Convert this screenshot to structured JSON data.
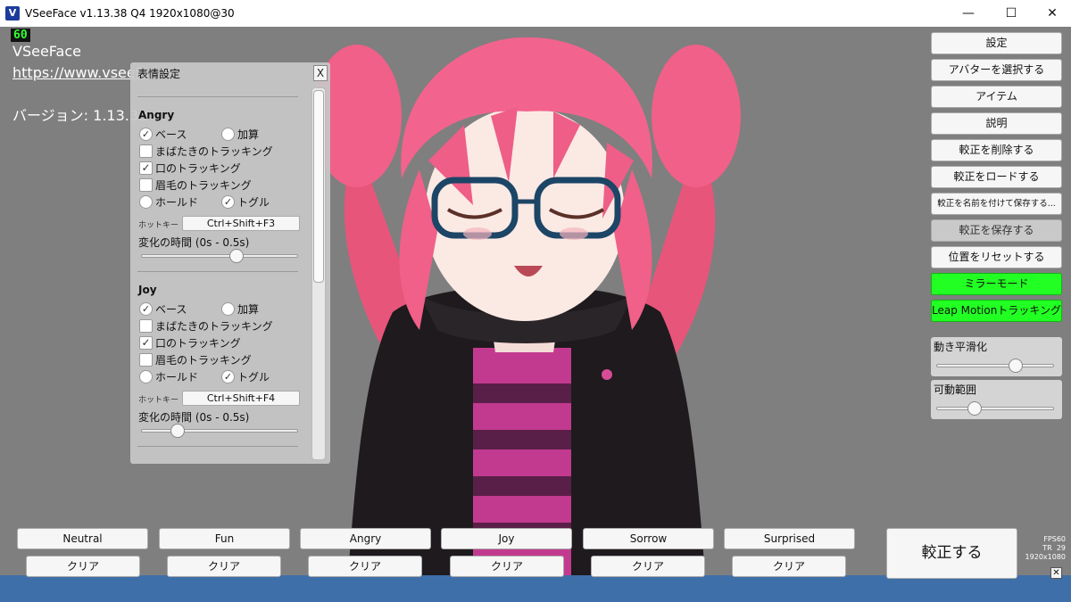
{
  "window": {
    "title": "VSeeFace v1.13.38 Q4 1920x1080@30",
    "app_icon_text": "V",
    "minimize": "—",
    "maximize": "☐",
    "close": "✕"
  },
  "overlay": {
    "fps": "60",
    "app_name": "VSeeFace",
    "url": "https://www.vseefa",
    "version": "バージョン: 1.13.38"
  },
  "expression_panel": {
    "title": "表情設定",
    "close": "X",
    "sections": [
      {
        "name": "Angry",
        "base_checked": true,
        "base_label": "ベース",
        "additive_label": "加算",
        "blink_label": "まばたきのトラッキング",
        "blink_checked": false,
        "mouth_label": "口のトラッキング",
        "mouth_checked": true,
        "brow_label": "眉毛のトラッキング",
        "brow_checked": false,
        "hold_label": "ホールド",
        "toggle_label": "トグル",
        "toggle_checked": true,
        "hotkey_label": "ホットキー",
        "hotkey": "Ctrl+Shift+F3",
        "range_label": "変化の時間 (0s - 0.5s)",
        "slider_value": 0.62
      },
      {
        "name": "Joy",
        "base_checked": true,
        "base_label": "ベース",
        "additive_label": "加算",
        "blink_label": "まばたきのトラッキング",
        "blink_checked": false,
        "mouth_label": "口のトラッキング",
        "mouth_checked": true,
        "brow_label": "眉毛のトラッキング",
        "brow_checked": false,
        "hold_label": "ホールド",
        "toggle_label": "トグル",
        "toggle_checked": true,
        "hotkey_label": "ホットキー",
        "hotkey": "Ctrl+Shift+F4",
        "range_label": "変化の時間 (0s - 0.5s)",
        "slider_value": 0.2
      }
    ]
  },
  "menu": {
    "settings": "設定",
    "select_avatar": "アバターを選択する",
    "items": "アイテム",
    "help": "説明",
    "delete_calibration": "較正を削除する",
    "load_calibration": "較正をロードする",
    "save_calibration_as": "較正を名前を付けて保存する...",
    "save_calibration": "較正を保存する",
    "reset_position": "位置をリセットする",
    "mirror_mode": "ミラーモード",
    "leap_motion": "Leap Motionトラッキング",
    "smoothing_label": "動き平滑化",
    "smoothing_value": 0.7,
    "range_label": "可動範囲",
    "range_value": 0.3
  },
  "bottom": {
    "expressions": [
      "Neutral",
      "Fun",
      "Angry",
      "Joy",
      "Sorrow",
      "Surprised"
    ],
    "clear_label": "クリア",
    "calibrate": "較正する",
    "stats": [
      "FPS60",
      "TR  29",
      "1920x1080"
    ],
    "corner_close": "✕"
  }
}
